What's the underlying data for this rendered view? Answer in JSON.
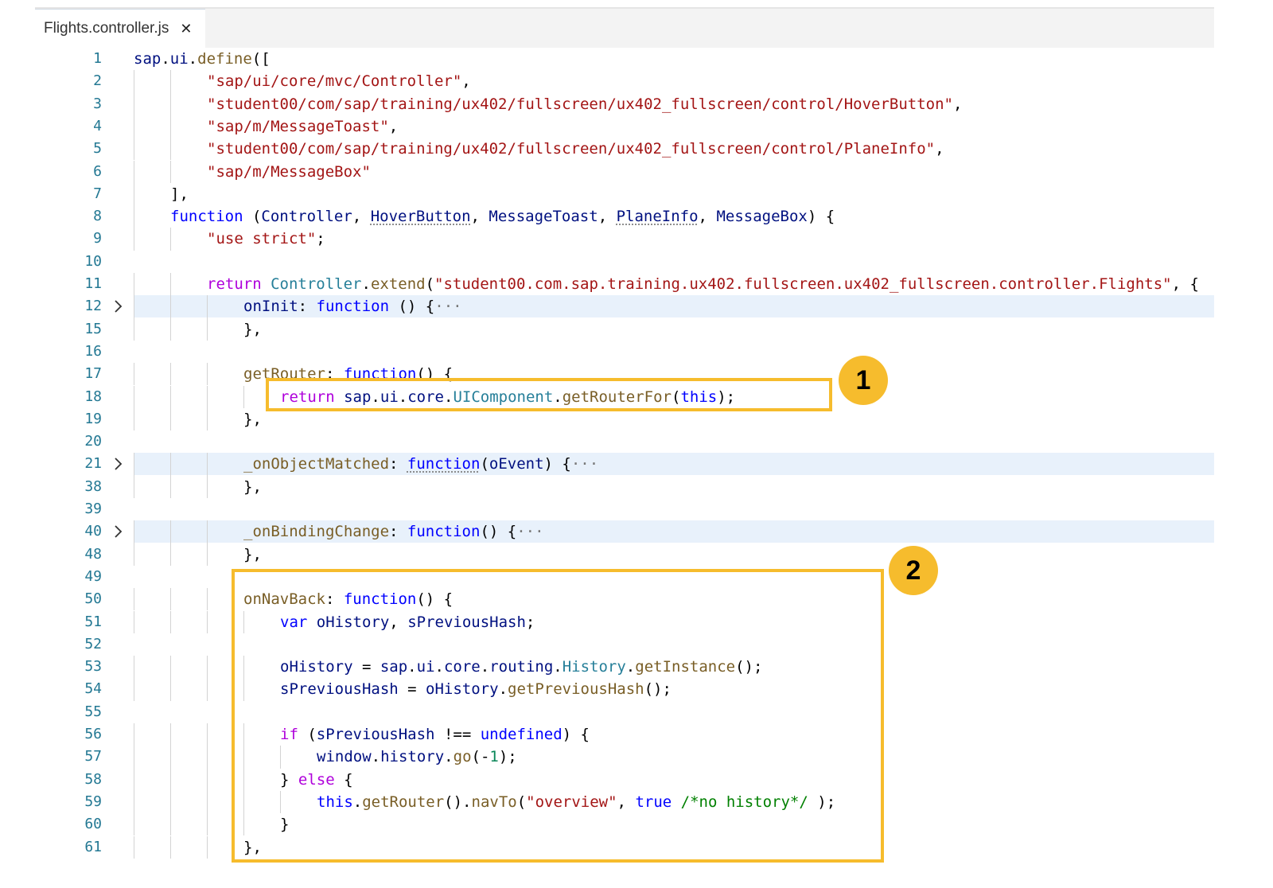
{
  "tab": {
    "filename": "Flights.controller.js",
    "close_glyph": "✕"
  },
  "callouts": [
    {
      "label": "1"
    },
    {
      "label": "2"
    }
  ],
  "colors": {
    "callout": "#f6bc2d",
    "line_number": "#237893",
    "fold_highlight": "#e8f1fb"
  },
  "lines": [
    {
      "n": "1",
      "ind": 0,
      "hl": false,
      "fold": false,
      "tokens": [
        [
          "id",
          "sap"
        ],
        [
          "",
          "."
        ],
        [
          "id",
          "ui"
        ],
        [
          "",
          "."
        ],
        [
          "fn",
          "define"
        ],
        [
          "",
          "(["
        ]
      ]
    },
    {
      "n": "2",
      "ind": 4,
      "hl": false,
      "fold": false,
      "tokens": [
        [
          "str",
          "\"sap/ui/core/mvc/Controller\""
        ],
        [
          "",
          ","
        ]
      ]
    },
    {
      "n": "3",
      "ind": 4,
      "hl": false,
      "fold": false,
      "tokens": [
        [
          "str",
          "\"student00/com/sap/training/ux402/fullscreen/ux402_fullscreen/control/HoverButton\""
        ],
        [
          "",
          ","
        ]
      ]
    },
    {
      "n": "4",
      "ind": 4,
      "hl": false,
      "fold": false,
      "tokens": [
        [
          "str",
          "\"sap/m/MessageToast\""
        ],
        [
          "",
          ","
        ]
      ]
    },
    {
      "n": "5",
      "ind": 4,
      "hl": false,
      "fold": false,
      "tokens": [
        [
          "str",
          "\"student00/com/sap/training/ux402/fullscreen/ux402_fullscreen/control/PlaneInfo\""
        ],
        [
          "",
          ","
        ]
      ]
    },
    {
      "n": "6",
      "ind": 4,
      "hl": false,
      "fold": false,
      "tokens": [
        [
          "str",
          "\"sap/m/MessageBox\""
        ]
      ]
    },
    {
      "n": "7",
      "ind": 2,
      "hl": false,
      "fold": false,
      "tokens": [
        [
          "",
          "],"
        ]
      ]
    },
    {
      "n": "8",
      "ind": 2,
      "hl": false,
      "fold": false,
      "tokens": [
        [
          "kw",
          "function"
        ],
        [
          "",
          " ("
        ],
        [
          "id",
          "Controller"
        ],
        [
          "",
          ", "
        ],
        [
          "id sq",
          "HoverButton"
        ],
        [
          "",
          ", "
        ],
        [
          "id",
          "MessageToast"
        ],
        [
          "",
          ", "
        ],
        [
          "id sq",
          "PlaneInfo"
        ],
        [
          "",
          ", "
        ],
        [
          "id",
          "MessageBox"
        ],
        [
          "",
          ") {"
        ]
      ]
    },
    {
      "n": "9",
      "ind": 4,
      "hl": false,
      "fold": false,
      "tokens": [
        [
          "str",
          "\"use strict\""
        ],
        [
          "",
          ";"
        ]
      ]
    },
    {
      "n": "10",
      "ind": 0,
      "hl": false,
      "fold": false,
      "tokens": []
    },
    {
      "n": "11",
      "ind": 4,
      "hl": false,
      "fold": false,
      "tokens": [
        [
          "ctl",
          "return"
        ],
        [
          "",
          " "
        ],
        [
          "ty",
          "Controller"
        ],
        [
          "",
          "."
        ],
        [
          "fn",
          "extend"
        ],
        [
          "",
          "("
        ],
        [
          "str",
          "\"student00.com.sap.training.ux402.fullscreen.ux402_fullscreen.controller.Flights\""
        ],
        [
          "",
          ", {"
        ]
      ]
    },
    {
      "n": "12",
      "ind": 6,
      "hl": true,
      "fold": true,
      "tokens": [
        [
          "id",
          "onInit"
        ],
        [
          "",
          ": "
        ],
        [
          "kw",
          "function"
        ],
        [
          "",
          " () {"
        ],
        [
          "dots",
          "···"
        ]
      ]
    },
    {
      "n": "15",
      "ind": 6,
      "hl": false,
      "fold": false,
      "tokens": [
        [
          "",
          "},"
        ]
      ]
    },
    {
      "n": "16",
      "ind": 0,
      "hl": false,
      "fold": false,
      "tokens": []
    },
    {
      "n": "17",
      "ind": 6,
      "hl": false,
      "fold": false,
      "tokens": [
        [
          "fn",
          "getRouter"
        ],
        [
          "",
          ": "
        ],
        [
          "kw",
          "function"
        ],
        [
          "",
          "() {"
        ]
      ]
    },
    {
      "n": "18",
      "ind": 8,
      "hl": false,
      "fold": false,
      "tokens": [
        [
          "ctl",
          "return"
        ],
        [
          "",
          " "
        ],
        [
          "id",
          "sap"
        ],
        [
          "",
          "."
        ],
        [
          "id",
          "ui"
        ],
        [
          "",
          "."
        ],
        [
          "id",
          "core"
        ],
        [
          "",
          "."
        ],
        [
          "ty",
          "UIComponent"
        ],
        [
          "",
          "."
        ],
        [
          "fn",
          "getRouterFor"
        ],
        [
          "",
          "("
        ],
        [
          "kw",
          "this"
        ],
        [
          "",
          ");"
        ]
      ]
    },
    {
      "n": "19",
      "ind": 6,
      "hl": false,
      "fold": false,
      "tokens": [
        [
          "",
          "},"
        ]
      ]
    },
    {
      "n": "20",
      "ind": 0,
      "hl": false,
      "fold": false,
      "tokens": []
    },
    {
      "n": "21",
      "ind": 6,
      "hl": true,
      "fold": true,
      "tokens": [
        [
          "fn",
          "_onObjectMatched"
        ],
        [
          "",
          ": "
        ],
        [
          "kw sq",
          "function"
        ],
        [
          "",
          "("
        ],
        [
          "id",
          "oEvent"
        ],
        [
          "",
          ") {"
        ],
        [
          "dots",
          "···"
        ]
      ]
    },
    {
      "n": "38",
      "ind": 6,
      "hl": false,
      "fold": false,
      "tokens": [
        [
          "",
          "},"
        ]
      ]
    },
    {
      "n": "39",
      "ind": 0,
      "hl": false,
      "fold": false,
      "tokens": []
    },
    {
      "n": "40",
      "ind": 6,
      "hl": true,
      "fold": true,
      "tokens": [
        [
          "fn",
          "_onBindingChange"
        ],
        [
          "",
          ": "
        ],
        [
          "kw",
          "function"
        ],
        [
          "",
          "() {"
        ],
        [
          "dots",
          "···"
        ]
      ]
    },
    {
      "n": "48",
      "ind": 6,
      "hl": false,
      "fold": false,
      "tokens": [
        [
          "",
          "},"
        ]
      ]
    },
    {
      "n": "49",
      "ind": 0,
      "hl": false,
      "fold": false,
      "tokens": []
    },
    {
      "n": "50",
      "ind": 6,
      "hl": false,
      "fold": false,
      "tokens": [
        [
          "fn",
          "onNavBack"
        ],
        [
          "",
          ": "
        ],
        [
          "kw",
          "function"
        ],
        [
          "",
          "() {"
        ]
      ]
    },
    {
      "n": "51",
      "ind": 8,
      "hl": false,
      "fold": false,
      "tokens": [
        [
          "kw",
          "var"
        ],
        [
          "",
          " "
        ],
        [
          "id",
          "oHistory"
        ],
        [
          "",
          ", "
        ],
        [
          "id",
          "sPreviousHash"
        ],
        [
          "",
          ";"
        ]
      ]
    },
    {
      "n": "52",
      "ind": 0,
      "hl": false,
      "fold": false,
      "tokens": []
    },
    {
      "n": "53",
      "ind": 8,
      "hl": false,
      "fold": false,
      "tokens": [
        [
          "id",
          "oHistory"
        ],
        [
          "",
          " = "
        ],
        [
          "id",
          "sap"
        ],
        [
          "",
          "."
        ],
        [
          "id",
          "ui"
        ],
        [
          "",
          "."
        ],
        [
          "id",
          "core"
        ],
        [
          "",
          "."
        ],
        [
          "id",
          "routing"
        ],
        [
          "",
          "."
        ],
        [
          "ty",
          "History"
        ],
        [
          "",
          "."
        ],
        [
          "fn",
          "getInstance"
        ],
        [
          "",
          "();"
        ]
      ]
    },
    {
      "n": "54",
      "ind": 8,
      "hl": false,
      "fold": false,
      "tokens": [
        [
          "id",
          "sPreviousHash"
        ],
        [
          "",
          " = "
        ],
        [
          "id",
          "oHistory"
        ],
        [
          "",
          "."
        ],
        [
          "fn",
          "getPreviousHash"
        ],
        [
          "",
          "();"
        ]
      ]
    },
    {
      "n": "55",
      "ind": 0,
      "hl": false,
      "fold": false,
      "tokens": []
    },
    {
      "n": "56",
      "ind": 8,
      "hl": false,
      "fold": false,
      "tokens": [
        [
          "ctl",
          "if"
        ],
        [
          "",
          " ("
        ],
        [
          "id",
          "sPreviousHash"
        ],
        [
          "",
          " !== "
        ],
        [
          "kw",
          "undefined"
        ],
        [
          "",
          ") {"
        ]
      ]
    },
    {
      "n": "57",
      "ind": 10,
      "hl": false,
      "fold": false,
      "tokens": [
        [
          "id",
          "window"
        ],
        [
          "",
          "."
        ],
        [
          "id",
          "history"
        ],
        [
          "",
          "."
        ],
        [
          "fn",
          "go"
        ],
        [
          "",
          "(-"
        ],
        [
          "num",
          "1"
        ],
        [
          "",
          ");"
        ]
      ]
    },
    {
      "n": "58",
      "ind": 8,
      "hl": false,
      "fold": false,
      "tokens": [
        [
          "",
          "} "
        ],
        [
          "ctl",
          "else"
        ],
        [
          "",
          " {"
        ]
      ]
    },
    {
      "n": "59",
      "ind": 10,
      "hl": false,
      "fold": false,
      "tokens": [
        [
          "kw",
          "this"
        ],
        [
          "",
          "."
        ],
        [
          "fn",
          "getRouter"
        ],
        [
          "",
          "()."
        ],
        [
          "fn",
          "navTo"
        ],
        [
          "",
          "("
        ],
        [
          "str",
          "\"overview\""
        ],
        [
          "",
          ", "
        ],
        [
          "kw",
          "true"
        ],
        [
          "",
          " "
        ],
        [
          "cm",
          "/*no history*/"
        ],
        [
          "",
          " );"
        ]
      ]
    },
    {
      "n": "60",
      "ind": 8,
      "hl": false,
      "fold": false,
      "tokens": [
        [
          "",
          "}"
        ]
      ]
    },
    {
      "n": "61",
      "ind": 6,
      "hl": false,
      "fold": false,
      "tokens": [
        [
          "",
          "},"
        ]
      ]
    }
  ]
}
